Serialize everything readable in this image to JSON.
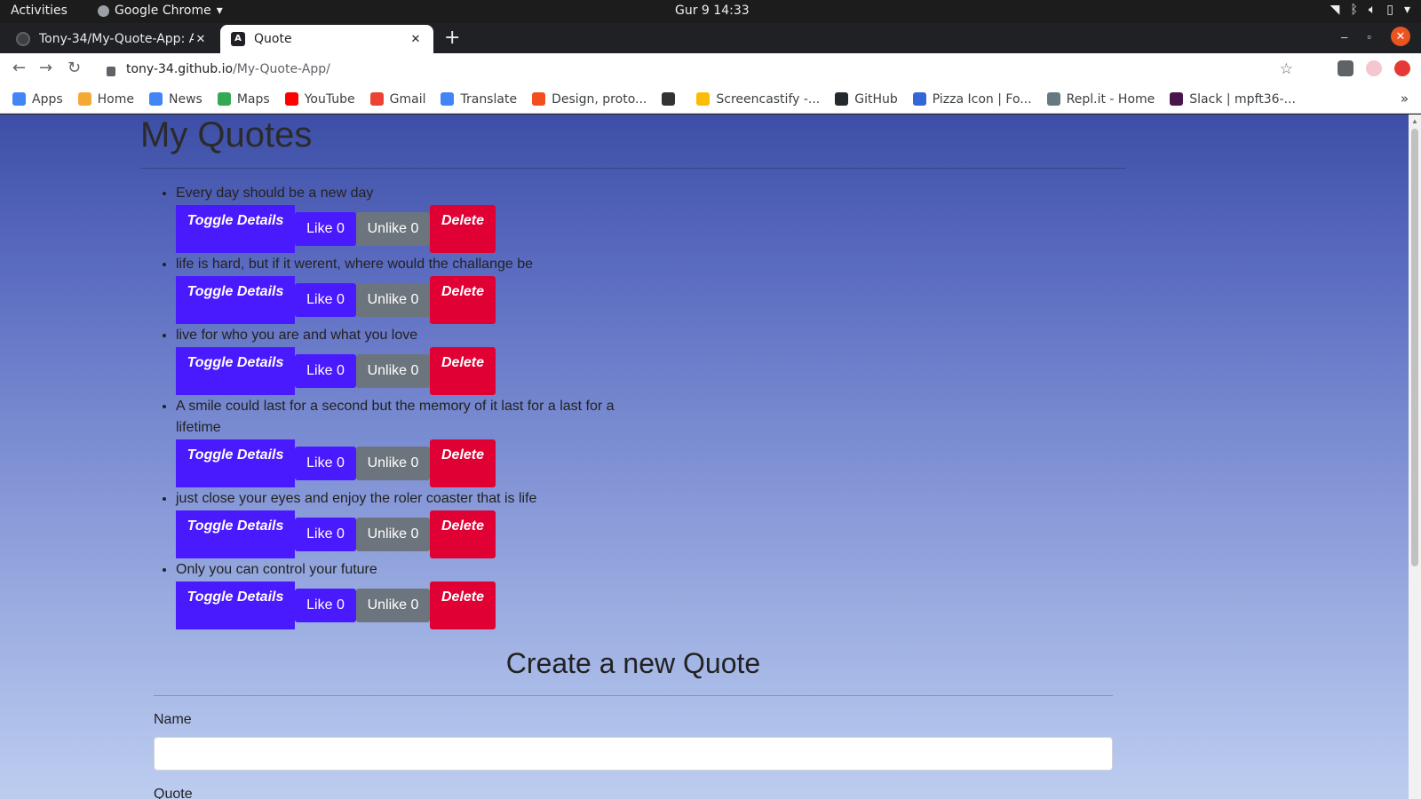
{
  "system_bar": {
    "activities": "Activities",
    "app_name": "Google Chrome",
    "clock": "Gur 9  14:33"
  },
  "browser": {
    "tabs": [
      {
        "title": "Tony-34/My-Quote-App: A"
      },
      {
        "title": "Quote"
      }
    ],
    "url_host": "tony-34.github.io",
    "url_path": "/My-Quote-App/",
    "bookmarks": [
      {
        "label": "Apps",
        "icon": "apps-grid-icon",
        "color": "#4285f4"
      },
      {
        "label": "Home",
        "icon": "home-icon",
        "color": "#f4a836"
      },
      {
        "label": "News",
        "icon": "news-icon",
        "color": "#4285f4"
      },
      {
        "label": "Maps",
        "icon": "maps-icon",
        "color": "#34a853"
      },
      {
        "label": "YouTube",
        "icon": "youtube-icon",
        "color": "#ff0000"
      },
      {
        "label": "Gmail",
        "icon": "gmail-icon",
        "color": "#ea4335"
      },
      {
        "label": "Translate",
        "icon": "translate-icon",
        "color": "#4285f4"
      },
      {
        "label": "Design, proto...",
        "icon": "figma-icon",
        "color": "#f24e1e"
      },
      {
        "label": "",
        "icon": "globe-icon",
        "color": "#333333"
      },
      {
        "label": "Screencastify -...",
        "icon": "screencastify-icon",
        "color": "#fbbc04"
      },
      {
        "label": "GitHub",
        "icon": "github-icon",
        "color": "#24292e"
      },
      {
        "label": "Pizza Icon | Fo...",
        "icon": "flag-icon",
        "color": "#3367d6"
      },
      {
        "label": "Repl.it - Home",
        "icon": "replit-icon",
        "color": "#667881"
      },
      {
        "label": "Slack | mpft36-...",
        "icon": "slack-icon",
        "color": "#4a154b"
      }
    ],
    "more": "»"
  },
  "page": {
    "title": "My Quotes",
    "quotes": [
      {
        "text": "Every day should be a new day",
        "toggle": "Toggle Details",
        "like": "Like 0",
        "unlike": "Unlike 0",
        "delete": "Delete"
      },
      {
        "text": "life is hard, but if it werent, where would the challange be",
        "toggle": "Toggle Details",
        "like": "Like 0",
        "unlike": "Unlike 0",
        "delete": "Delete"
      },
      {
        "text": "live for who you are and what you love",
        "toggle": "Toggle Details",
        "like": "Like 0",
        "unlike": "Unlike 0",
        "delete": "Delete"
      },
      {
        "text": "A smile could last for a second but the memory of it last for a last for a lifetime",
        "toggle": "Toggle Details",
        "like": "Like 0",
        "unlike": "Unlike 0",
        "delete": "Delete"
      },
      {
        "text": "just close your eyes and enjoy the roler coaster that is life",
        "toggle": "Toggle Details",
        "like": "Like 0",
        "unlike": "Unlike 0",
        "delete": "Delete"
      },
      {
        "text": "Only you can control your future",
        "toggle": "Toggle Details",
        "like": "Like 0",
        "unlike": "Unlike 0",
        "delete": "Delete"
      }
    ],
    "form": {
      "heading": "Create a new Quote",
      "name_label": "Name",
      "name_value": "",
      "quote_label": "Quote"
    }
  },
  "colors": {
    "primary_button": "#4a1aff",
    "secondary_button": "#6c757d",
    "danger_button": "#e00034"
  }
}
